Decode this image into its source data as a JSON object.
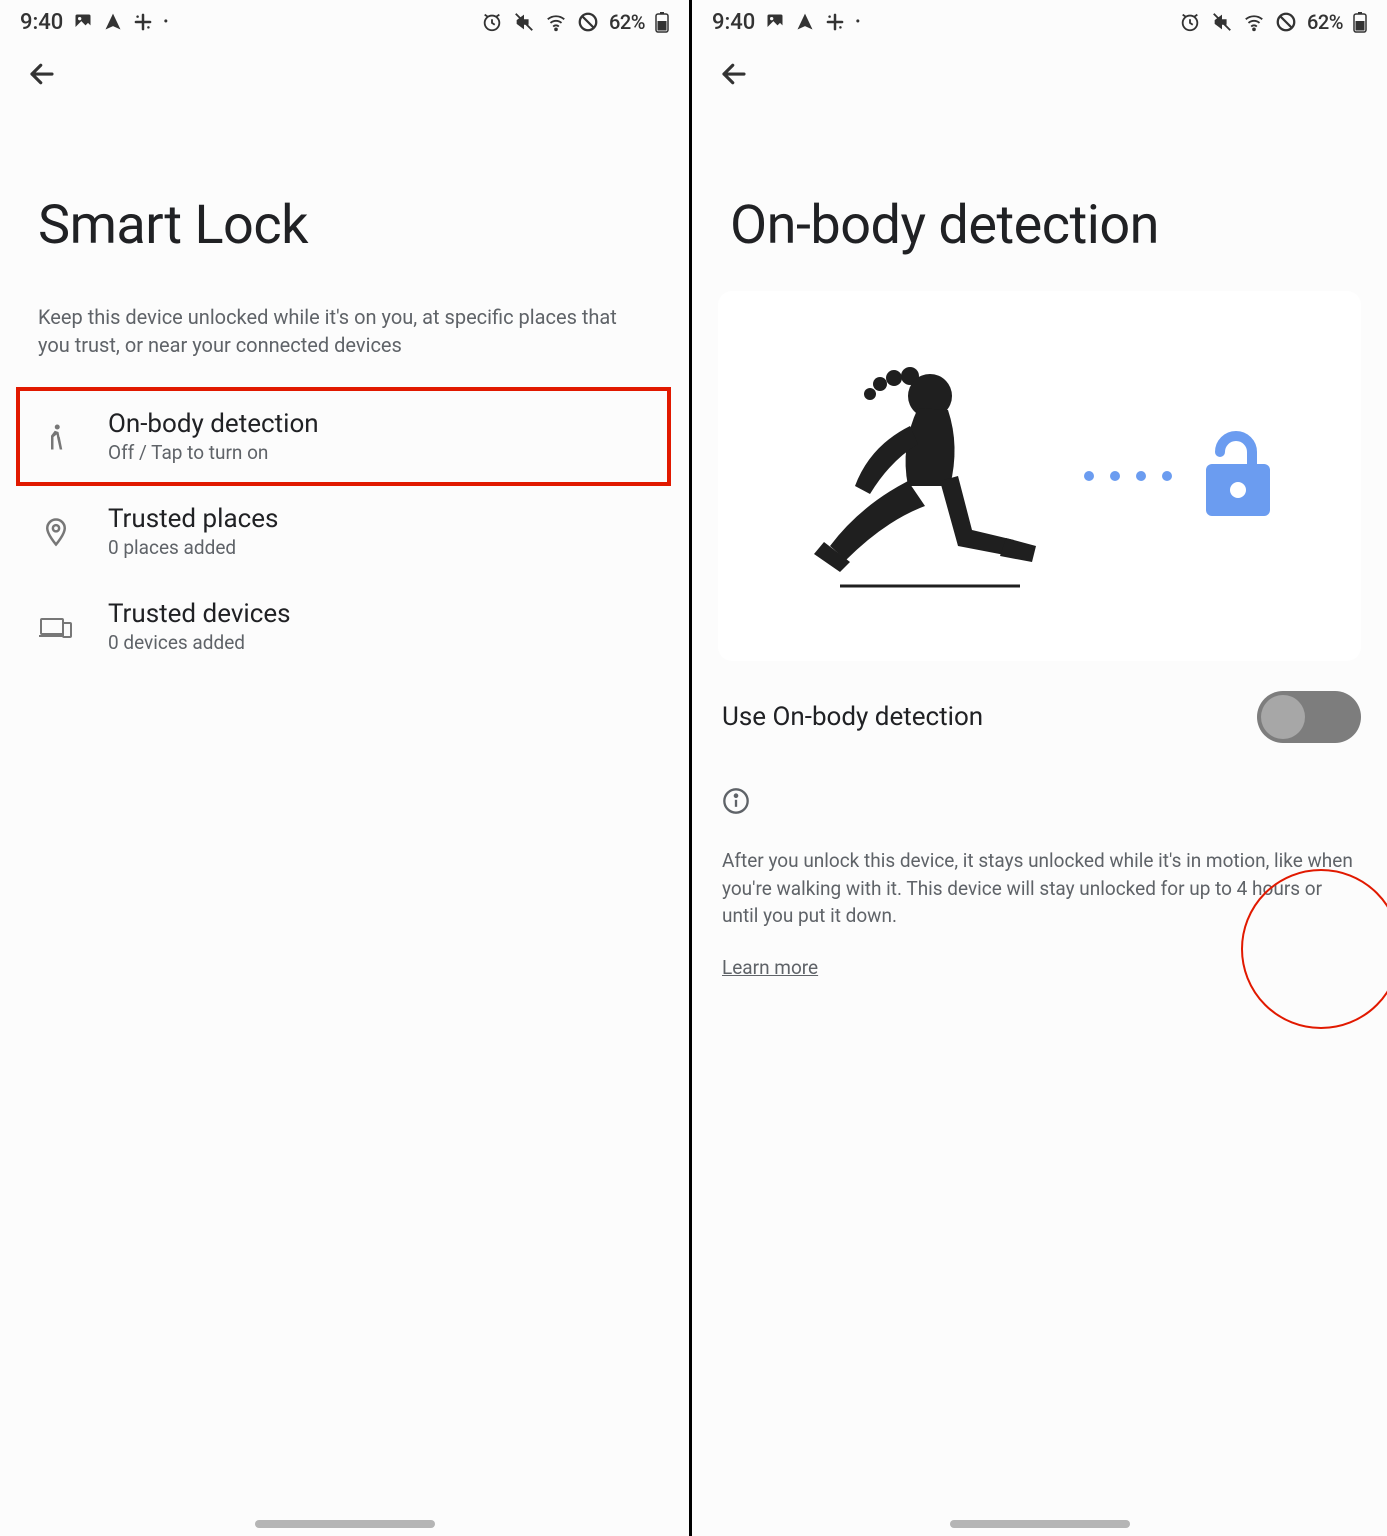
{
  "status": {
    "time": "9:40",
    "battery": "62%"
  },
  "left": {
    "title": "Smart Lock",
    "subtitle": "Keep this device unlocked while it's on you, at specific places that you trust, or near your connected devices",
    "rows": [
      {
        "title": "On-body detection",
        "sub": "Off / Tap to turn on"
      },
      {
        "title": "Trusted places",
        "sub": "0 places added"
      },
      {
        "title": "Trusted devices",
        "sub": "0 devices added"
      }
    ]
  },
  "right": {
    "title": "On-body detection",
    "toggle_label": "Use On-body detection",
    "info_text": "After you unlock this device, it stays unlocked while it's in motion, like when you're walking with it. This device will stay unlocked for up to 4 hours or until you put it down.",
    "learn_more": "Learn more"
  }
}
